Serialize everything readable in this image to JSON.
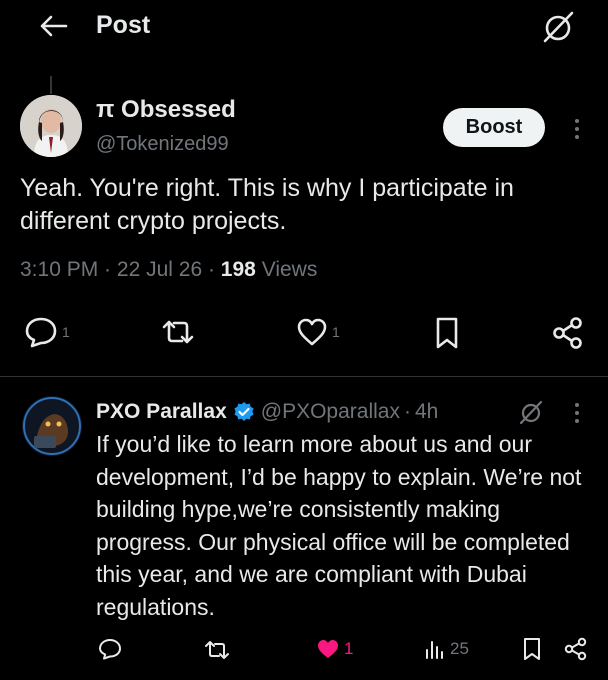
{
  "header": {
    "title": "Post",
    "back_icon": "arrow-left-icon",
    "grok_icon": "grok-icon"
  },
  "post": {
    "author_name": "π Obsessed",
    "author_handle": "@Tokenized99",
    "boost_label": "Boost",
    "text": "Yeah. You're right. This is why I participate in different crypto projects.",
    "time": "3:10 PM",
    "date": "22 Jul 26",
    "separator": " · ",
    "views_count": "198",
    "views_label": "Views",
    "actions": {
      "reply_count": "1",
      "repost_count": "",
      "like_count": "1"
    }
  },
  "reply": {
    "author_name": "PXO Parallax",
    "author_handle": "@PXOparallax",
    "dot": "·",
    "time": "4h",
    "text": "If you’d like to learn more about us and our development, I’d be happy to explain. We’re not building hype,we’re consistently making progress. Our physical office will be completed this year, and we are compliant with Dubai regulations.",
    "actions": {
      "reply_count": "",
      "repost_count": "",
      "like_count": "1",
      "views_count": "25"
    }
  },
  "colors": {
    "background": "#000000",
    "text_primary": "#e7e9ea",
    "text_secondary": "#71767b",
    "like_active": "#f91880",
    "verified": "#1d9bf0",
    "divider": "#2f3336"
  }
}
